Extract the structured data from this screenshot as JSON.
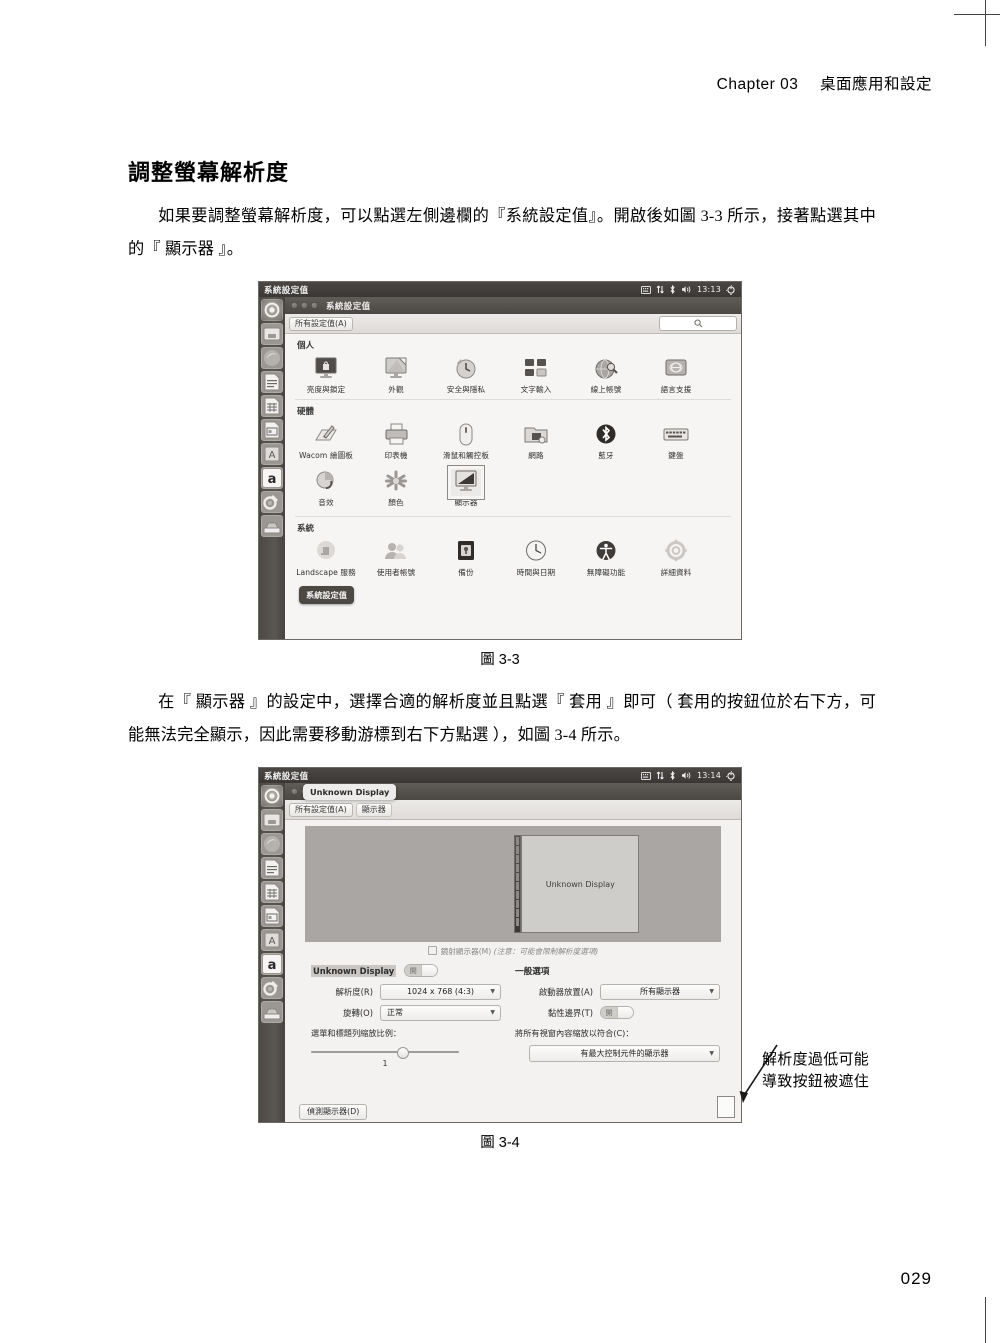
{
  "page": {
    "running_head": "Chapter 03",
    "running_head_sub": "桌面應用和設定",
    "page_number": "029"
  },
  "article": {
    "heading": "調整螢幕解析度",
    "paragraph1": "如果要調整螢幕解析度，可以點選左側邊欄的『系統設定值』。開啟後如圖 3-3 所示，接著點選其中的『 顯示器 』。",
    "paragraph2": "在『 顯示器 』的設定中，選擇合適的解析度並且點選『 套用 』即可（ 套用的按鈕位於右下方，可能無法完全顯示，因此需要移動游標到右下方點選 ），如圖 3-4 所示。",
    "figure1_caption": "圖 3-3",
    "figure2_caption": "圖 3-4",
    "annotation_line1": "解析度過低可能",
    "annotation_line2": "導致按鈕被遮住"
  },
  "figure1": {
    "panel": {
      "title": "系統設定值",
      "clock": "13:13",
      "indicators": [
        "keyboard-indicator-icon",
        "network-indicator-icon",
        "bluetooth-indicator-icon",
        "volume-indicator-icon",
        "power-gear-icon"
      ]
    },
    "window": {
      "title": "系統設定值",
      "toolbar_button": "所有設定值(A)",
      "search_placeholder": ""
    },
    "sections": [
      {
        "label": "個人",
        "items": [
          {
            "label": "亮度與鎖定",
            "icon": "brightness-lock-icon"
          },
          {
            "label": "外觀",
            "icon": "appearance-icon"
          },
          {
            "label": "安全與隱私",
            "icon": "security-privacy-icon"
          },
          {
            "label": "文字輸入",
            "icon": "text-entry-icon"
          },
          {
            "label": "線上帳號",
            "icon": "online-accounts-icon"
          },
          {
            "label": "語言支援",
            "icon": "language-support-icon"
          }
        ]
      },
      {
        "label": "硬體",
        "items": [
          {
            "label": "Wacom 繪圖板",
            "icon": "wacom-tablet-icon"
          },
          {
            "label": "印表機",
            "icon": "printer-icon"
          },
          {
            "label": "滑鼠和觸控板",
            "icon": "mouse-touchpad-icon"
          },
          {
            "label": "網路",
            "icon": "network-icon"
          },
          {
            "label": "藍牙",
            "icon": "bluetooth-icon"
          },
          {
            "label": "鍵盤",
            "icon": "keyboard-icon"
          },
          {
            "label": "音效",
            "icon": "sound-icon"
          },
          {
            "label": "顏色",
            "icon": "color-icon"
          },
          {
            "label": "顯示器",
            "icon": "displays-icon",
            "selected": true
          }
        ]
      },
      {
        "label": "系統",
        "items": [
          {
            "label": "Landscape 服務",
            "icon": "landscape-service-icon"
          },
          {
            "label": "使用者帳號",
            "icon": "user-accounts-icon"
          },
          {
            "label": "備份",
            "icon": "backup-icon"
          },
          {
            "label": "時間與日期",
            "icon": "time-date-icon"
          },
          {
            "label": "無障礙功能",
            "icon": "accessibility-icon"
          },
          {
            "label": "詳細資料",
            "icon": "details-icon"
          }
        ]
      }
    ],
    "launcher_tooltip": "系統設定值"
  },
  "figure2": {
    "panel": {
      "title": "系統設定值",
      "clock": "13:14"
    },
    "window": {
      "title": "顯示器",
      "tooltip": "Unknown Display",
      "breadcrumb_all": "所有設定值(A)",
      "breadcrumb_current": "顯示器"
    },
    "preview": {
      "monitor_label": "Unknown Display"
    },
    "mirror": {
      "label": "鏡射顯示器(M)",
      "note": "(注意：可能會限制解析度選項)",
      "checked": false
    },
    "left_column": {
      "display_name": "Unknown Display",
      "power_toggle": "開",
      "resolution_label": "解析度(R)",
      "resolution_value": "1024 x 768 (4:3)",
      "rotation_label": "旋轉(O)",
      "rotation_value": "正常",
      "scale_label": "選單和標題列縮放比例：",
      "scale_value": "1"
    },
    "right_column": {
      "heading": "一般選項",
      "launcher_label": "啟動器放置(A)",
      "launcher_value": "所有顯示器",
      "sticky_label": "黏性邊界(T)",
      "sticky_toggle": "開",
      "scalefit_label": "將所有視窗內容縮放以符合(C)：",
      "scalefit_value": "有最大控制元件的顯示器"
    },
    "detect_button": "偵測顯示器(D)"
  }
}
